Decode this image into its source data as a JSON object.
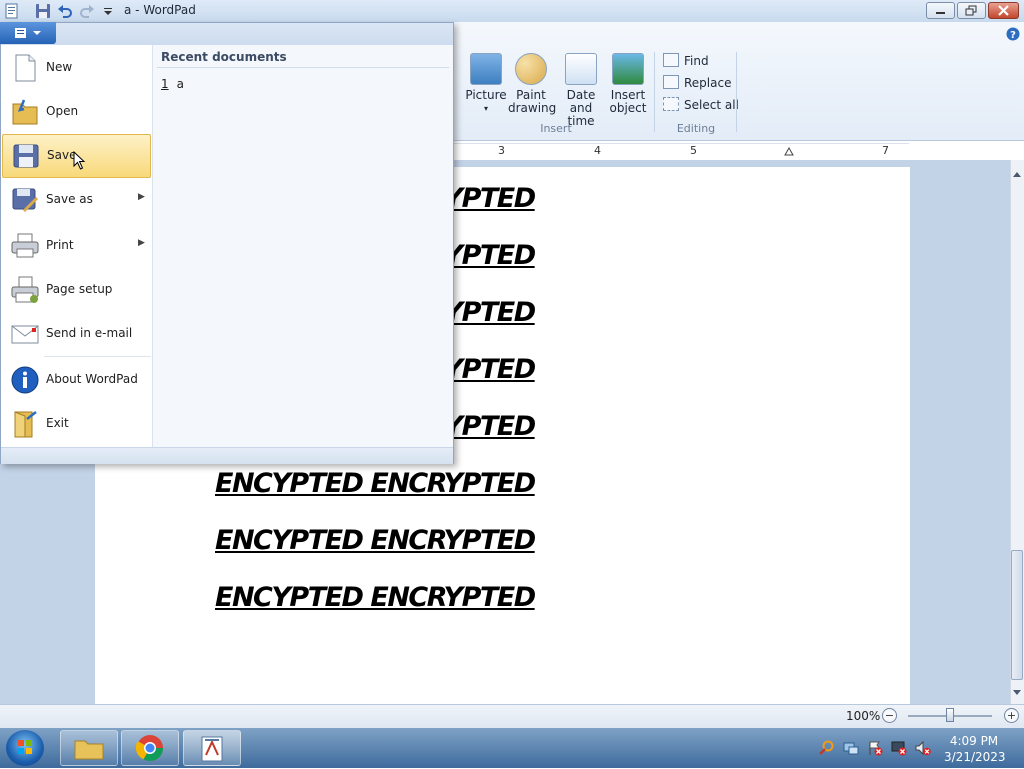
{
  "window": {
    "title": "a - WordPad"
  },
  "ribbon": {
    "insert_group": {
      "label": "Insert",
      "items": [
        {
          "label_line1": "Picture",
          "label_line2": "▾"
        },
        {
          "label_line1": "Paint",
          "label_line2": "drawing"
        },
        {
          "label_line1": "Date and",
          "label_line2": "time"
        },
        {
          "label_line1": "Insert",
          "label_line2": "object"
        }
      ]
    },
    "editing_group": {
      "label": "Editing",
      "find": "Find",
      "replace": "Replace",
      "select_all": "Select all"
    }
  },
  "ruler": {
    "marks": [
      "3",
      "4",
      "5",
      "7"
    ]
  },
  "document": {
    "lines": [
      "ENCYPTED ENCRYPTED",
      "ENCYPTED ENCRYPTED",
      "ENCYPTED ENCRYPTED",
      "ENCYPTED ENCRYPTED",
      "ENCYPTED ENCRYPTED",
      "ENCYPTED ENCRYPTED",
      "ENCYPTED ENCRYPTED",
      "ENCYPTED ENCRYPTED"
    ]
  },
  "app_menu": {
    "items": [
      {
        "label": "New"
      },
      {
        "label": "Open"
      },
      {
        "label": "Save"
      },
      {
        "label": "Save as"
      },
      {
        "label": "Print"
      },
      {
        "label": "Page setup"
      },
      {
        "label": "Send in e-mail"
      },
      {
        "label": "About WordPad"
      },
      {
        "label": "Exit"
      }
    ],
    "recent_header": "Recent documents",
    "recent": [
      {
        "index": "1",
        "name": "a"
      }
    ]
  },
  "statusbar": {
    "zoom": "100%",
    "zoom_out": "−",
    "zoom_in": "+",
    "zoom_level": 0.5
  },
  "taskbar": {
    "time": "4:09 PM",
    "date": "3/21/2023"
  }
}
